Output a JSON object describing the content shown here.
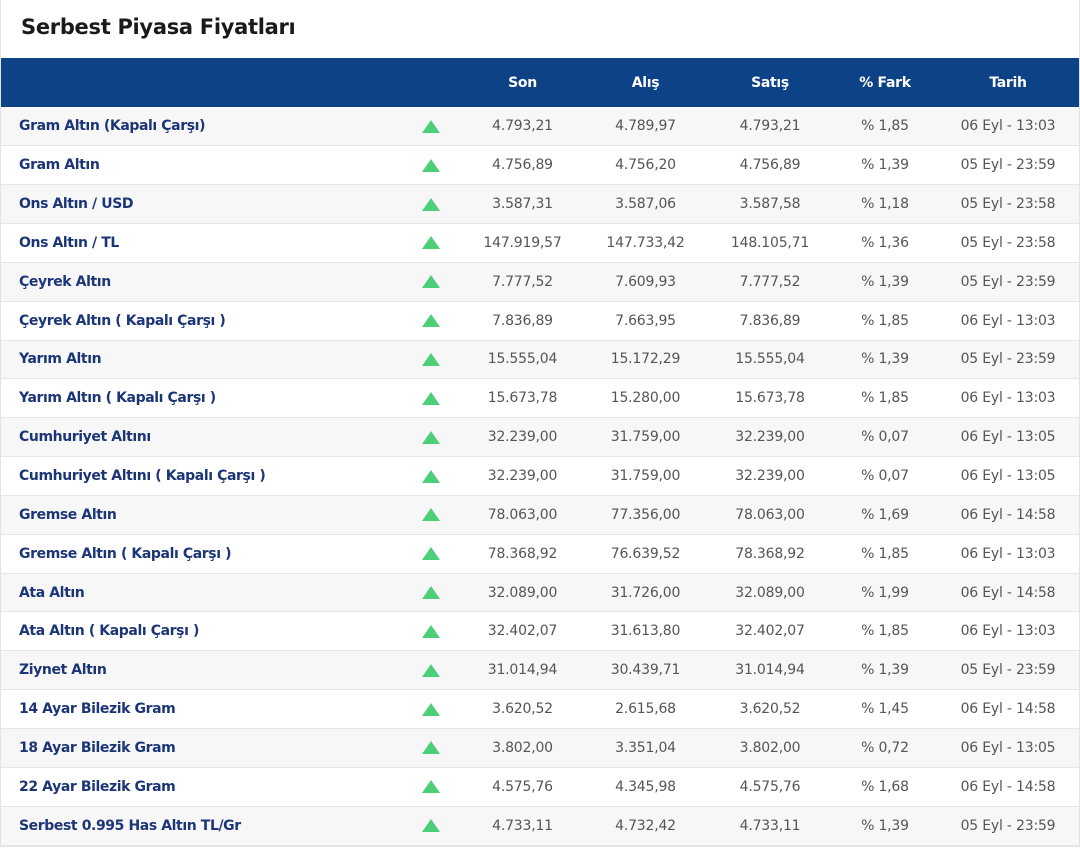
{
  "title": "Serbest Piyasa Fiyatları",
  "colors": {
    "header_bg": "#0d4286",
    "name_text": "#1b3577",
    "up_arrow": "#4ccf78"
  },
  "columns": [
    "",
    "",
    "Son",
    "Alış",
    "Satış",
    "% Fark",
    "Tarih"
  ],
  "rows": [
    {
      "name": "Gram Altın (Kapalı Çarşı)",
      "trend": "up-icon",
      "son": "4.793,21",
      "alis": "4.789,97",
      "satis": "4.793,21",
      "fark": "% 1,85",
      "tarih": "06 Eyl - 13:03"
    },
    {
      "name": "Gram Altın",
      "trend": "up-icon",
      "son": "4.756,89",
      "alis": "4.756,20",
      "satis": "4.756,89",
      "fark": "% 1,39",
      "tarih": "05 Eyl - 23:59"
    },
    {
      "name": "Ons Altın / USD",
      "trend": "up-icon",
      "son": "3.587,31",
      "alis": "3.587,06",
      "satis": "3.587,58",
      "fark": "% 1,18",
      "tarih": "05 Eyl - 23:58"
    },
    {
      "name": "Ons Altın / TL",
      "trend": "up-icon",
      "son": "147.919,57",
      "alis": "147.733,42",
      "satis": "148.105,71",
      "fark": "% 1,36",
      "tarih": "05 Eyl - 23:58"
    },
    {
      "name": "Çeyrek Altın",
      "trend": "up-icon",
      "son": "7.777,52",
      "alis": "7.609,93",
      "satis": "7.777,52",
      "fark": "% 1,39",
      "tarih": "05 Eyl - 23:59"
    },
    {
      "name": "Çeyrek Altın ( Kapalı Çarşı )",
      "trend": "up-icon",
      "son": "7.836,89",
      "alis": "7.663,95",
      "satis": "7.836,89",
      "fark": "% 1,85",
      "tarih": "06 Eyl - 13:03"
    },
    {
      "name": "Yarım Altın",
      "trend": "up-icon",
      "son": "15.555,04",
      "alis": "15.172,29",
      "satis": "15.555,04",
      "fark": "% 1,39",
      "tarih": "05 Eyl - 23:59"
    },
    {
      "name": "Yarım Altın ( Kapalı Çarşı )",
      "trend": "up-icon",
      "son": "15.673,78",
      "alis": "15.280,00",
      "satis": "15.673,78",
      "fark": "% 1,85",
      "tarih": "06 Eyl - 13:03"
    },
    {
      "name": "Cumhuriyet Altını",
      "trend": "up-icon",
      "son": "32.239,00",
      "alis": "31.759,00",
      "satis": "32.239,00",
      "fark": "% 0,07",
      "tarih": "06 Eyl - 13:05"
    },
    {
      "name": "Cumhuriyet Altını ( Kapalı Çarşı )",
      "trend": "up-icon",
      "son": "32.239,00",
      "alis": "31.759,00",
      "satis": "32.239,00",
      "fark": "% 0,07",
      "tarih": "06 Eyl - 13:05"
    },
    {
      "name": "Gremse Altın",
      "trend": "up-icon",
      "son": "78.063,00",
      "alis": "77.356,00",
      "satis": "78.063,00",
      "fark": "% 1,69",
      "tarih": "06 Eyl - 14:58"
    },
    {
      "name": "Gremse Altın ( Kapalı Çarşı )",
      "trend": "up-icon",
      "son": "78.368,92",
      "alis": "76.639,52",
      "satis": "78.368,92",
      "fark": "% 1,85",
      "tarih": "06 Eyl - 13:03"
    },
    {
      "name": "Ata Altın",
      "trend": "up-icon",
      "son": "32.089,00",
      "alis": "31.726,00",
      "satis": "32.089,00",
      "fark": "% 1,99",
      "tarih": "06 Eyl - 14:58"
    },
    {
      "name": "Ata Altın ( Kapalı Çarşı )",
      "trend": "up-icon",
      "son": "32.402,07",
      "alis": "31.613,80",
      "satis": "32.402,07",
      "fark": "% 1,85",
      "tarih": "06 Eyl - 13:03"
    },
    {
      "name": "Ziynet Altın",
      "trend": "up-icon",
      "son": "31.014,94",
      "alis": "30.439,71",
      "satis": "31.014,94",
      "fark": "% 1,39",
      "tarih": "05 Eyl - 23:59"
    },
    {
      "name": "14 Ayar Bilezik Gram",
      "trend": "up-icon",
      "son": "3.620,52",
      "alis": "2.615,68",
      "satis": "3.620,52",
      "fark": "% 1,45",
      "tarih": "06 Eyl - 14:58"
    },
    {
      "name": "18 Ayar Bilezik Gram",
      "trend": "up-icon",
      "son": "3.802,00",
      "alis": "3.351,04",
      "satis": "3.802,00",
      "fark": "% 0,72",
      "tarih": "06 Eyl - 13:05"
    },
    {
      "name": "22 Ayar Bilezik Gram",
      "trend": "up-icon",
      "son": "4.575,76",
      "alis": "4.345,98",
      "satis": "4.575,76",
      "fark": "% 1,68",
      "tarih": "06 Eyl - 14:58"
    },
    {
      "name": "Serbest 0.995 Has Altın TL/Gr",
      "trend": "up-icon",
      "son": "4.733,11",
      "alis": "4.732,42",
      "satis": "4.733,11",
      "fark": "% 1,39",
      "tarih": "05 Eyl - 23:59"
    }
  ]
}
